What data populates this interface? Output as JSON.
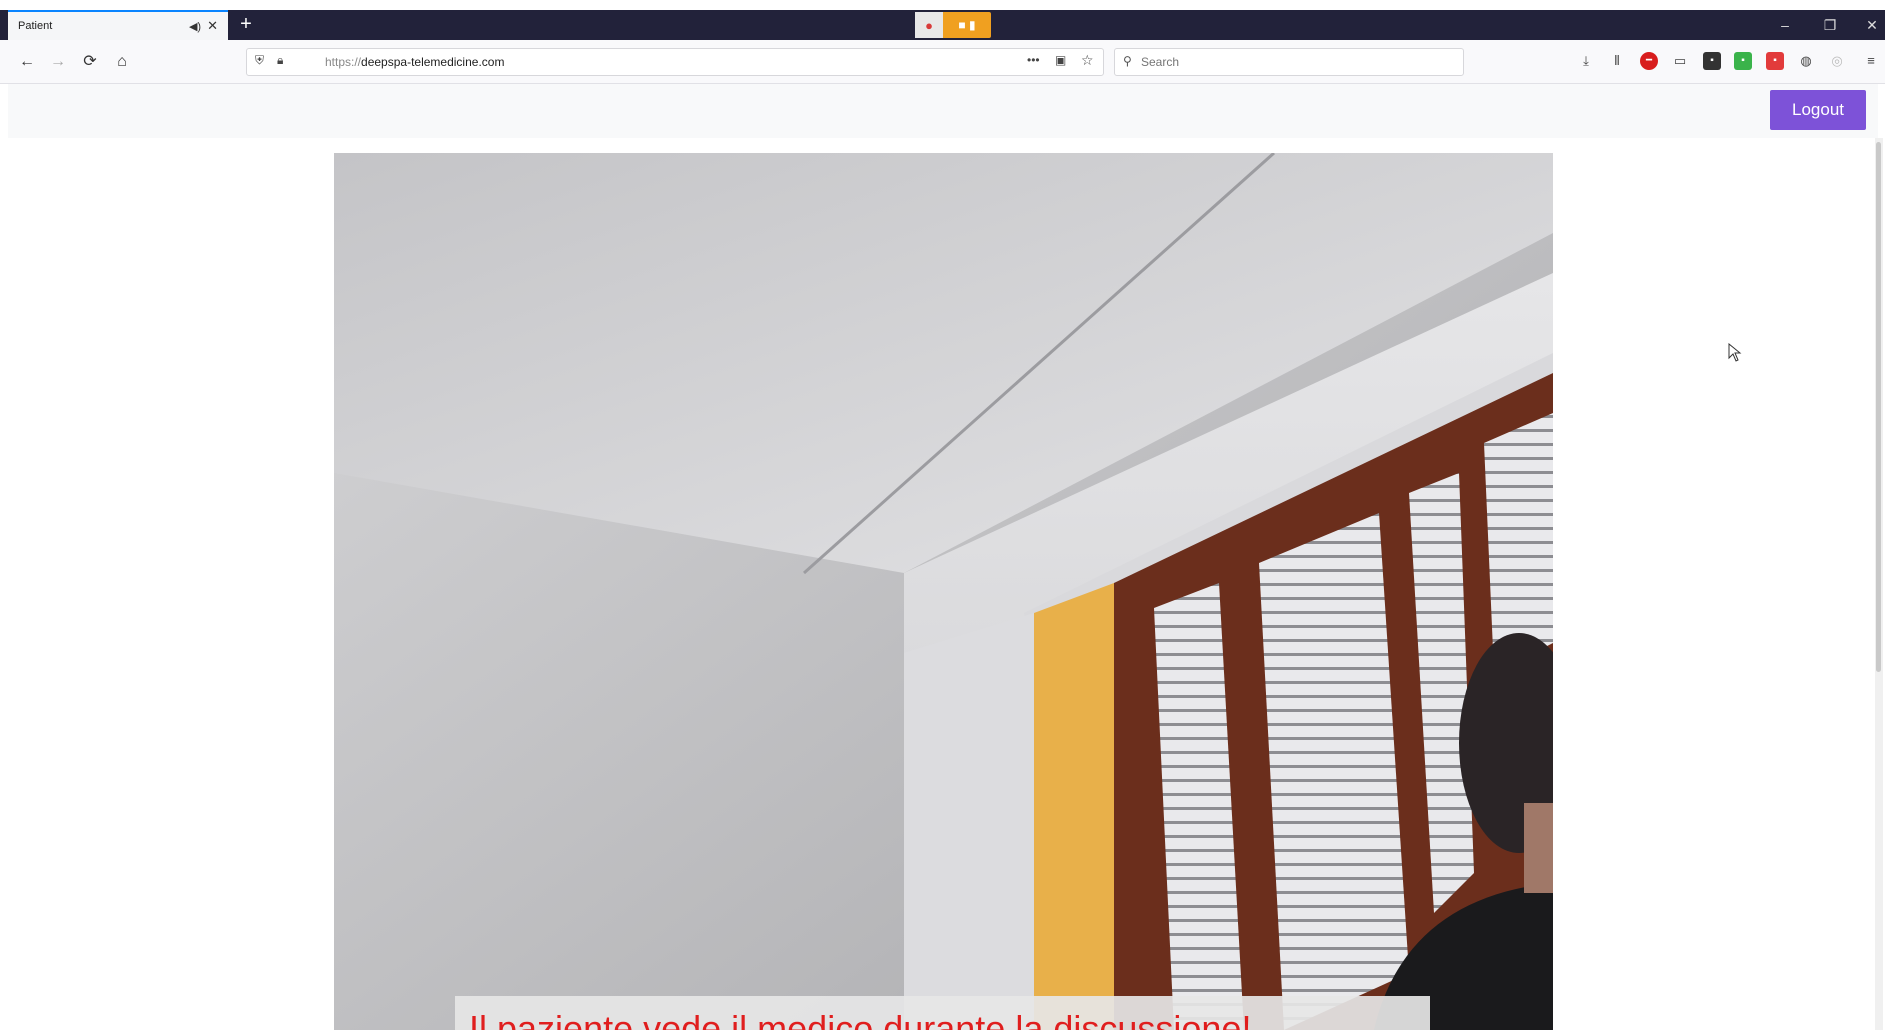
{
  "browser": {
    "tab": {
      "title": "Patient",
      "audio_icon": "speaker-icon",
      "close_icon": "close-icon"
    },
    "new_tab_icon": "plus-icon",
    "sharing_indicator": {
      "camera_icon": "camera-icon",
      "mic_icon": "microphone-icon"
    },
    "window_controls": {
      "minimize": "–",
      "restore": "❐",
      "close": "✕"
    },
    "nav": {
      "back_icon": "←",
      "forward_icon": "→",
      "reload_icon": "⟳",
      "home_icon": "⌂"
    },
    "url": {
      "scheme": "https://",
      "host": "deepspa-telemedicine.com"
    },
    "url_actions": {
      "more": "•••",
      "pocket": "▣",
      "bookmark": "☆"
    },
    "search": {
      "placeholder": "Search",
      "value": ""
    }
  },
  "app": {
    "logout_label": "Logout"
  },
  "video": {
    "caption": "Il paziente vede il medico durante la discussione!"
  },
  "colors": {
    "accent": "#7d52d8",
    "caption_text": "#e01e1e",
    "tabstrip": "#22223a"
  }
}
